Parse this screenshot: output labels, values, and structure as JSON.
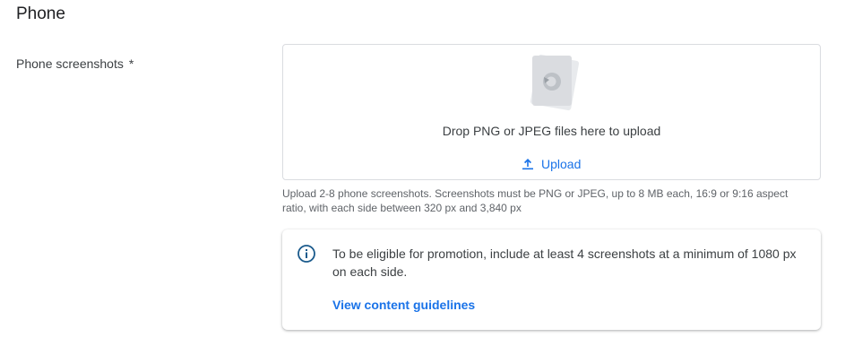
{
  "section": {
    "title": "Phone"
  },
  "field": {
    "label": "Phone screenshots",
    "required_marker": "*"
  },
  "dropzone": {
    "illustration_icon": "image-stack-icon",
    "text": "Drop PNG or JPEG files here to upload",
    "upload_icon": "upload-icon",
    "upload_label": "Upload"
  },
  "hint": {
    "text": "Upload 2-8 phone screenshots. Screenshots must be PNG or JPEG, up to 8 MB each, 16:9 or 9:16 aspect ratio, with each side between 320 px and 3,840 px"
  },
  "info_card": {
    "icon": "info-icon",
    "text": "To be eligible for promotion, include at least 4 screenshots at a minimum of 1080 px on each side.",
    "link_label": "View content guidelines"
  },
  "colors": {
    "accent": "#1a73e8",
    "info_icon": "#1a5a8c",
    "border": "#dadce0",
    "text_secondary": "#5f6368"
  }
}
